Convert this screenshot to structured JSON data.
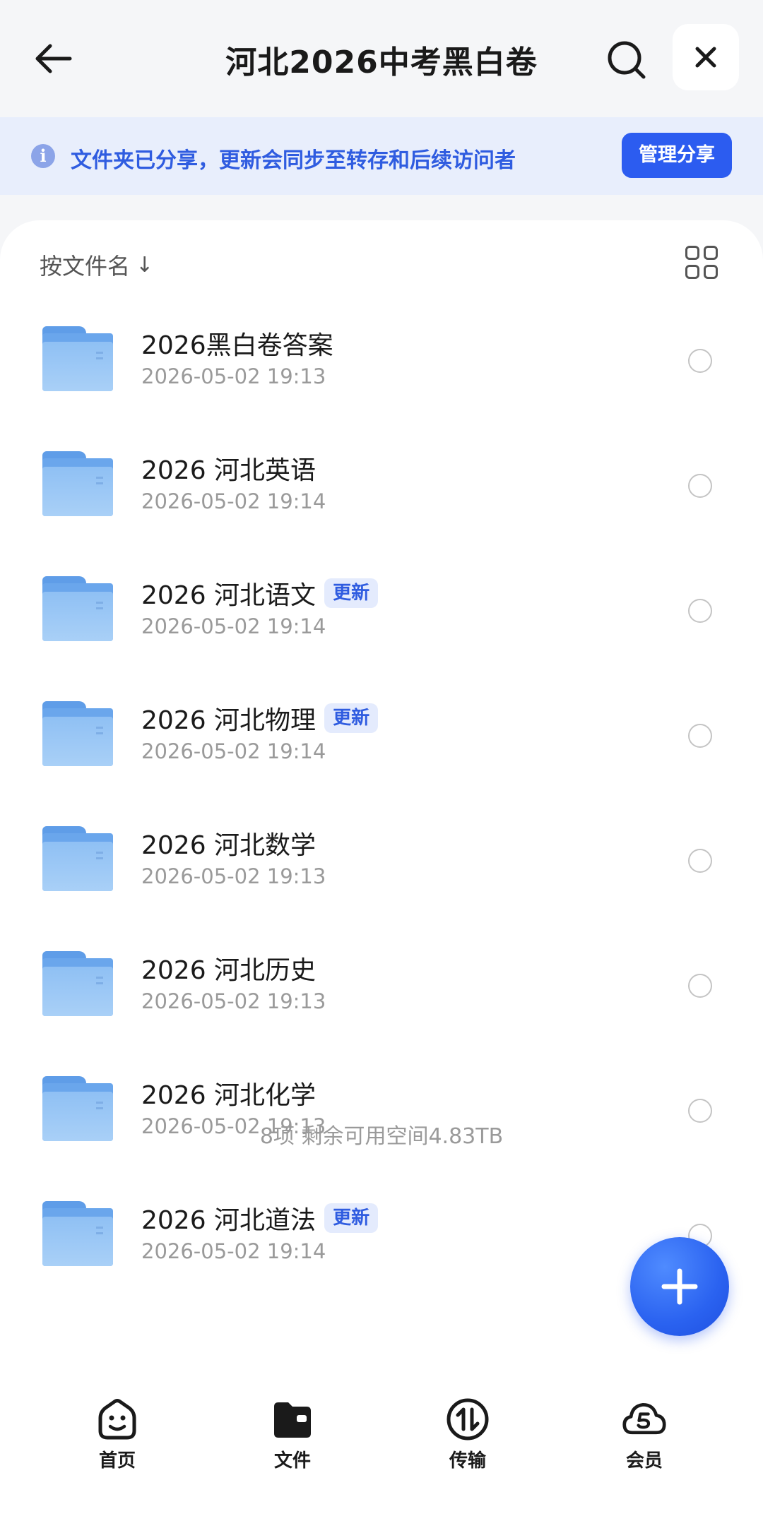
{
  "header": {
    "title": "河北2026中考黑白卷"
  },
  "banner": {
    "info_icon": "i",
    "text": "文件夹已分享，更新会同步至转存和后续访问者",
    "manage_label": "管理分享"
  },
  "sort": {
    "label": "按文件名",
    "arrow": "↓"
  },
  "files": [
    {
      "name": "2026黑白卷答案",
      "date": "2026-05-02 19:13",
      "badge": ""
    },
    {
      "name": "2026 河北英语",
      "date": "2026-05-02 19:14",
      "badge": ""
    },
    {
      "name": "2026 河北语文",
      "date": "2026-05-02 19:14",
      "badge": "更新"
    },
    {
      "name": "2026 河北物理",
      "date": "2026-05-02 19:14",
      "badge": "更新"
    },
    {
      "name": "2026 河北数学",
      "date": "2026-05-02 19:13",
      "badge": ""
    },
    {
      "name": "2026 河北历史",
      "date": "2026-05-02 19:13",
      "badge": ""
    },
    {
      "name": "2026 河北化学",
      "date": "2026-05-02 19:13",
      "badge": ""
    },
    {
      "name": "2026 河北道法",
      "date": "2026-05-02 19:14",
      "badge": "更新"
    }
  ],
  "footer": {
    "info": "8项 剩余可用空间4.83TB"
  },
  "tabs": [
    {
      "label": "首页",
      "icon": "home-face-icon"
    },
    {
      "label": "文件",
      "icon": "folder-icon"
    },
    {
      "label": "传输",
      "icon": "transfer-icon"
    },
    {
      "label": "会员",
      "icon": "vip-cloud-icon"
    }
  ],
  "colors": {
    "accent": "#2c5cf0",
    "banner_bg": "#e8eefc",
    "badge_bg": "#e4ebfd"
  }
}
